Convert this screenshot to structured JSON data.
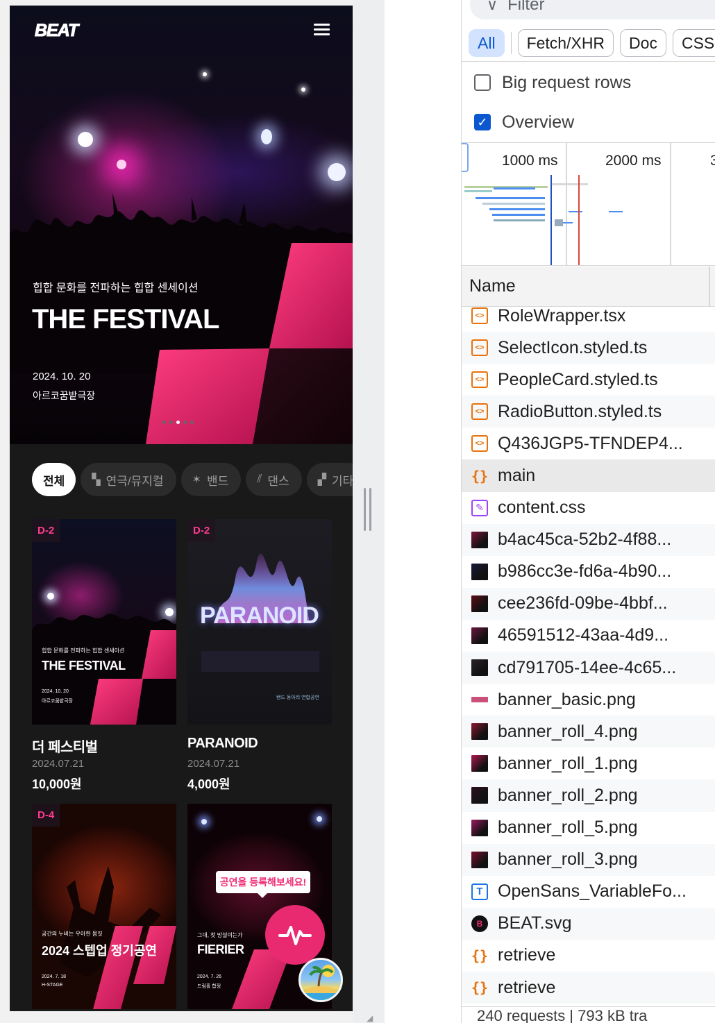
{
  "app": {
    "logo": "BEAT",
    "hero": {
      "subtitle": "힙합 문화를 전파하는 힙합 센세이션",
      "title": "THE FESTIVAL",
      "date": "2024. 10. 20",
      "venue": "아르코꿈밭극장",
      "slide_count": 5,
      "active_slide": 3
    },
    "categories": [
      {
        "label": "전체",
        "icon": "none",
        "active": true
      },
      {
        "label": "연극/뮤지컬",
        "icon": "theater-icon",
        "active": false
      },
      {
        "label": "밴드",
        "icon": "band-icon",
        "active": false
      },
      {
        "label": "댄스",
        "icon": "dance-icon",
        "active": false
      },
      {
        "label": "기타",
        "icon": "etc-icon",
        "active": false
      }
    ],
    "cards": [
      {
        "dday": "D-2",
        "title": "더 페스티벌",
        "date": "2024.07.21",
        "price": "10,000원",
        "poster_sub": "힙합 문화를 전파하는 힙합 센세이션",
        "poster_title": "THE FESTIVAL",
        "poster_date": "2024. 10. 20",
        "poster_venue": "아르코꿈밭극장"
      },
      {
        "dday": "D-2",
        "title": "PARANOID",
        "date": "2024.07.21",
        "price": "4,000원",
        "poster_title": "PARANOID",
        "poster_note": "밴드 동아리 연합공연"
      },
      {
        "dday": "D-4",
        "poster_sub": "공간의 누비는 우아한 몸짓",
        "poster_title": "2024 스텝업 정기공연",
        "poster_date": "2024. 7. 18",
        "poster_venue": "H-STAGE"
      },
      {
        "poster_sub": "그대, 첫 망설이는가",
        "poster_title": "FIERIER",
        "poster_date": "2024. 7. 26",
        "poster_venue": "드림홀 합정"
      }
    ],
    "register_tip": "공연을 등록해보세요!",
    "fab_icon": "pulse-icon"
  },
  "devtools": {
    "filter_placeholder": "Filter",
    "type_filters": [
      "All",
      "Fetch/XHR",
      "Doc",
      "CSS"
    ],
    "active_type": "All",
    "options": [
      {
        "label": "Big request rows",
        "checked": false
      },
      {
        "label": "Overview",
        "checked": true
      }
    ],
    "overview_ticks": [
      "1000 ms",
      "2000 ms",
      "3"
    ],
    "column_header": "Name",
    "requests": [
      {
        "name": "RoleWrapper.tsx",
        "type": "script"
      },
      {
        "name": "SelectIcon.styled.ts",
        "type": "script"
      },
      {
        "name": "PeopleCard.styled.ts",
        "type": "script"
      },
      {
        "name": "RadioButton.styled.ts",
        "type": "script"
      },
      {
        "name": "Q436JGP5-TFNDEP4...",
        "type": "script"
      },
      {
        "name": "main",
        "type": "fetch"
      },
      {
        "name": "content.css",
        "type": "css"
      },
      {
        "name": "b4ac45ca-52b2-4f88...",
        "type": "img"
      },
      {
        "name": "b986cc3e-fd6a-4b90...",
        "type": "img"
      },
      {
        "name": "cee236fd-09be-4bbf...",
        "type": "img"
      },
      {
        "name": "46591512-43aa-4d9...",
        "type": "img"
      },
      {
        "name": "cd791705-14ee-4c65...",
        "type": "img"
      },
      {
        "name": "banner_basic.png",
        "type": "img"
      },
      {
        "name": "banner_roll_4.png",
        "type": "img"
      },
      {
        "name": "banner_roll_1.png",
        "type": "img"
      },
      {
        "name": "banner_roll_2.png",
        "type": "img"
      },
      {
        "name": "banner_roll_5.png",
        "type": "img"
      },
      {
        "name": "banner_roll_3.png",
        "type": "img"
      },
      {
        "name": "OpenSans_VariableFo...",
        "type": "font"
      },
      {
        "name": "BEAT.svg",
        "type": "svg"
      },
      {
        "name": "retrieve",
        "type": "fetch"
      },
      {
        "name": "retrieve",
        "type": "fetch"
      }
    ],
    "selected_request": "main",
    "status_bar": "240 requests | 793 kB tra"
  }
}
